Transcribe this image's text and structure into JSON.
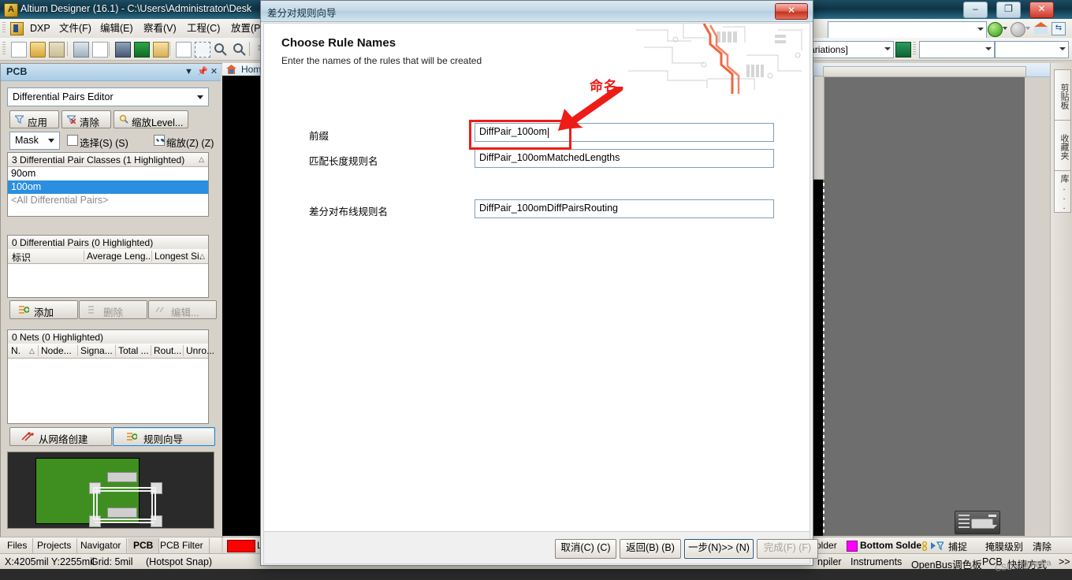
{
  "app": {
    "title": "Altium Designer (16.1) - C:\\Users\\Administrator\\Desk",
    "icon": "altium-logo-icon",
    "window_buttons": {
      "minimize": "–",
      "restore": "❐",
      "close": "✕"
    }
  },
  "menubar": {
    "items": [
      {
        "label": "DXP",
        "mnemonic": "X"
      },
      {
        "label": "文件(F)"
      },
      {
        "label": "编辑(E)"
      },
      {
        "label": "察看(V)"
      },
      {
        "label": "工程(C)"
      },
      {
        "label": "放置(P)"
      }
    ]
  },
  "toolbar": {
    "icons": [
      "new-document-icon",
      "open-folder-icon",
      "save-icon",
      "print-icon",
      "print-preview-icon",
      "pcb-board-icon",
      "schematic-icon",
      "library-icon",
      "zoom-document-icon",
      "zoom-area-icon",
      "zoom-select-icon",
      "zoom-filter-icon",
      "cut-scissors-icon"
    ],
    "browse_combo_value": "",
    "variations_combo_value": "Variations]",
    "nav_back_icon": "back-arrow-icon",
    "nav_forward_icon": "forward-arrow-icon",
    "home_icon": "home-icon",
    "refresh_icon": "refresh-icon",
    "sheet_icon": "sheet-symbol-icon"
  },
  "pcb_panel": {
    "title": "PCB",
    "header_buttons": [
      "dropdown-icon",
      "pin-icon",
      "close-icon"
    ],
    "mode_combo": "Differential Pairs Editor",
    "buttons": [
      {
        "label": "应用",
        "icon": "filter-apply-icon"
      },
      {
        "label": "清除",
        "icon": "filter-clear-icon"
      },
      {
        "label": "缩放Level...",
        "icon": "magnifier-icon"
      }
    ],
    "mask_combo": "Mask",
    "select_checkbox": {
      "label": "选择(S) (S)",
      "checked": false
    },
    "zoom_checkbox": {
      "label": "缩放(Z) (Z)",
      "checked": true
    },
    "classes_list": {
      "header": "3 Differential Pair Classes (1 Highlighted)",
      "sort_glyph": "△",
      "rows": [
        {
          "label": "90om",
          "selected": false,
          "dim": false
        },
        {
          "label": "100om",
          "selected": true,
          "dim": false
        },
        {
          "label": "<All Differential Pairs>",
          "selected": false,
          "dim": true
        }
      ]
    },
    "pairs_list": {
      "header": "0 Differential Pairs (0 Highlighted)",
      "columns": [
        "标识",
        "Average Leng...",
        "Longest Si..."
      ],
      "sort_glyph": "△",
      "rows": []
    },
    "pairs_buttons": [
      {
        "label": "添加",
        "icon": "add-icon",
        "enabled": true
      },
      {
        "label": "删除",
        "icon": "delete-icon",
        "enabled": false
      },
      {
        "label": "编辑...",
        "icon": "edit-icon",
        "enabled": false
      }
    ],
    "nets_list": {
      "header": "0 Nets (0 Highlighted)",
      "columns": [
        "N.",
        "Node...",
        "Signa...",
        "Total ...",
        "Rout...",
        "Unro..."
      ],
      "sort_glyph": "△",
      "rows": []
    },
    "nets_buttons": [
      {
        "label": "从网络创建",
        "icon": "create-from-nets-icon",
        "highlighted": false
      },
      {
        "label": "规则向导",
        "icon": "rule-wizard-icon",
        "highlighted": true
      }
    ],
    "preview_name": "pcb-thumbnail-preview"
  },
  "left_tabs": {
    "items": [
      {
        "label": "Files",
        "active": false
      },
      {
        "label": "Projects",
        "active": false
      },
      {
        "label": "Navigator",
        "active": false
      },
      {
        "label": "PCB",
        "active": true
      },
      {
        "label": "PCB Filter",
        "active": false
      }
    ]
  },
  "document_tab": {
    "label": "Hom",
    "icon": "home-icon"
  },
  "status_bar": {
    "coordinates": "X:4205mil Y:2255mil",
    "grid": "Grid: 5mil",
    "snap": "(Hotspot Snap)"
  },
  "layer_bar": {
    "color_swatch_left": "#ff0000",
    "items": [
      "LS",
      "Solder",
      "Bottom Solde",
      "捕捉",
      "掩膜级别",
      "清除"
    ],
    "bottom_solder_swatch": "#ff00ff"
  },
  "bottom_panel_tabs": {
    "items": [
      "npiler",
      "Instruments",
      "OpenBus调色板",
      "PCB",
      "快捷方式"
    ],
    "more": ">>"
  },
  "right_vertical_tabs": {
    "items": [
      "剪贴板",
      "收藏夹",
      "库..."
    ]
  },
  "watermark": "CSDN @naiva",
  "wizard": {
    "title": "差分对规则向导",
    "close_label": "✕",
    "heading": "Choose Rule Names",
    "subheading": "Enter the names of the rules that will be created",
    "fields": [
      {
        "label": "前缀",
        "value": "DiffPair_100om",
        "focused": true
      },
      {
        "label": "匹配长度规则名",
        "value": "DiffPair_100omMatchedLengths",
        "focused": false
      },
      {
        "label": "差分对布线规则名",
        "value": "DiffPair_100omDiffPairsRouting",
        "focused": false
      }
    ],
    "footer_buttons": [
      {
        "label": "取消(C) (C)",
        "enabled": true,
        "default": false
      },
      {
        "label": "返回(B) (B)",
        "enabled": true,
        "default": false
      },
      {
        "label": "一步(N)>> (N)",
        "enabled": true,
        "default": true
      },
      {
        "label": "完成(F) (F)",
        "enabled": false,
        "default": false
      }
    ]
  },
  "annotation": {
    "text": "命名",
    "color": "#ee1c17",
    "arrow_name": "red-annotation-arrow",
    "box_name": "red-highlight-box"
  }
}
